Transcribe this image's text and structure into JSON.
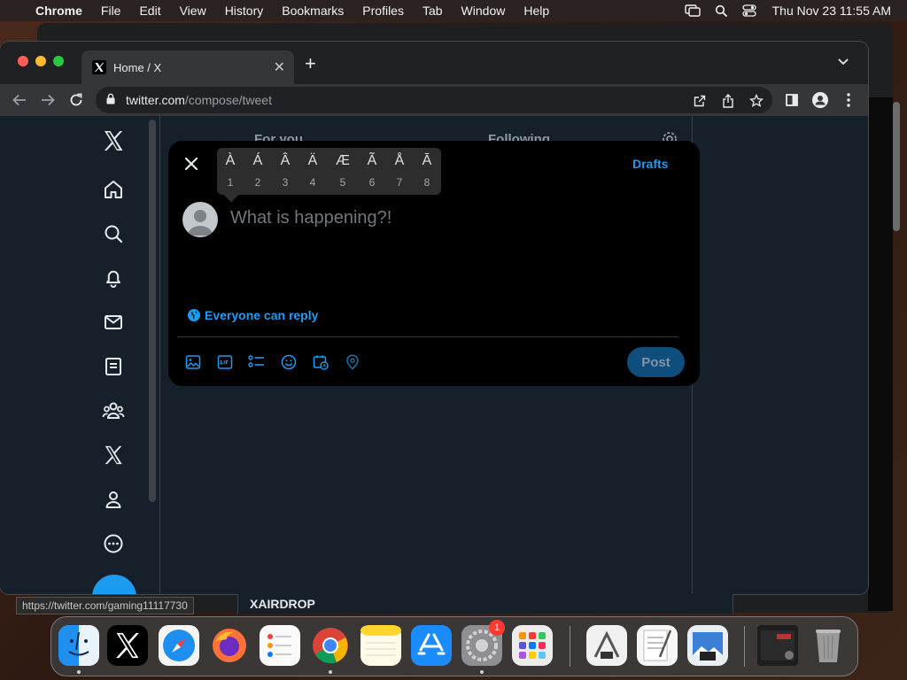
{
  "menubar": {
    "app_name": "Chrome",
    "menus": [
      "File",
      "Edit",
      "View",
      "History",
      "Bookmarks",
      "Profiles",
      "Tab",
      "Window",
      "Help"
    ],
    "clock": "Thu Nov 23  11:55 AM"
  },
  "browser": {
    "tab_title": "Home / X",
    "url_host": "twitter.com",
    "url_path": "/compose/tweet"
  },
  "compose_modal": {
    "drafts_label": "Drafts",
    "placeholder": "What is happening?!",
    "reply_setting": "Everyone can reply",
    "post_label": "Post"
  },
  "accent_popup": {
    "chars": [
      "À",
      "Á",
      "Â",
      "Ä",
      "Æ",
      "Ã",
      "Å",
      "Ā"
    ],
    "numbers": [
      "1",
      "2",
      "3",
      "4",
      "5",
      "6",
      "7",
      "8"
    ]
  },
  "feed": {
    "tab_for_you": "For you",
    "tab_following": "Following"
  },
  "status_url": "https://twitter.com/gaming11117730",
  "below_window_text": "XAIRDROP",
  "dock": {
    "system_settings_badge": "1"
  }
}
